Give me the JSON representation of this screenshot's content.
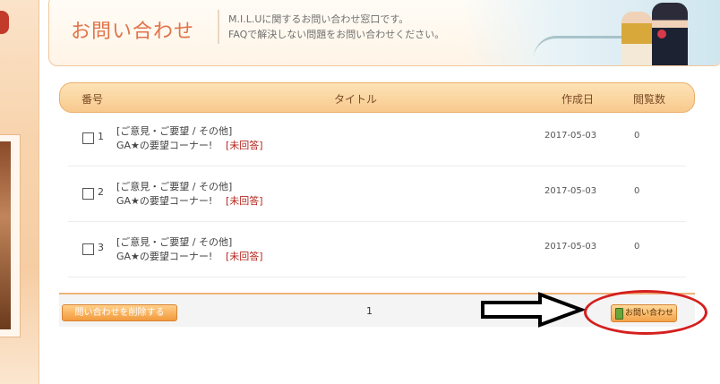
{
  "header": {
    "title": "お問い合わせ",
    "desc_line1": "M.I.L.Uに関するお問い合わせ窓口です。",
    "desc_line2": "FAQで解決しない問題をお問い合わせください。"
  },
  "table": {
    "columns": {
      "no": "番号",
      "title": "タイトル",
      "date": "作成日",
      "views": "閲覧数"
    },
    "rows": [
      {
        "no": "1",
        "category": "[ご意見・ご要望 / その他]",
        "title": "GA★の要望コーナー!",
        "status": "[未回答]",
        "date": "2017-05-03",
        "views": "0"
      },
      {
        "no": "2",
        "category": "[ご意見・ご要望 / その他]",
        "title": "GA★の要望コーナー!",
        "status": "[未回答]",
        "date": "2017-05-03",
        "views": "0"
      },
      {
        "no": "3",
        "category": "[ご意見・ご要望 / その他]",
        "title": "GA★の要望コーナー!",
        "status": "[未回答]",
        "date": "2017-05-03",
        "views": "0"
      }
    ]
  },
  "footer": {
    "delete_label": "問い合わせを削除する",
    "page": "1",
    "inquiry_label": "お問い合わせ"
  },
  "colors": {
    "accent": "#e0744a",
    "header_bar": "#f8c98d",
    "status_red": "#b4271f",
    "annotation_red": "#d51f1f"
  },
  "icons": [
    "pen-icon",
    "checkbox",
    "arrow-annotation"
  ]
}
